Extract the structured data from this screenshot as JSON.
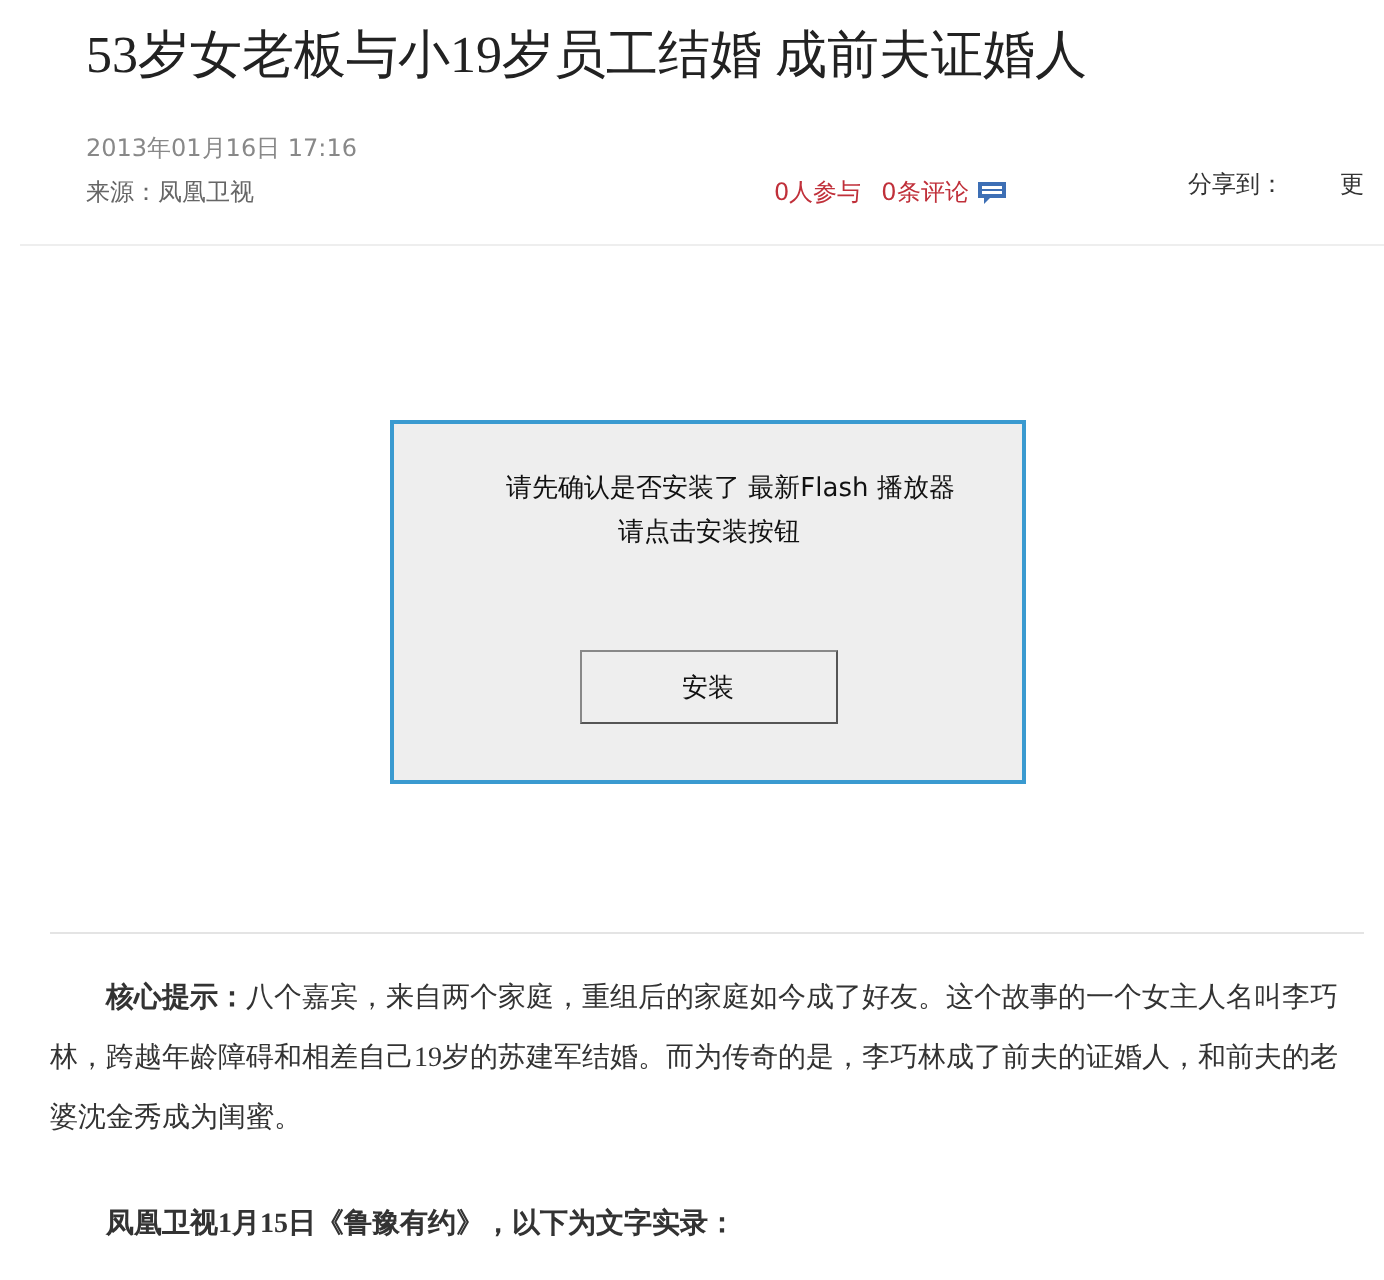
{
  "article": {
    "title": "53岁女老板与小19岁员工结婚 成前夫证婚人",
    "date": "2013年01月16日 17:16",
    "source": "来源：凤凰卫视",
    "participants": "0人参与",
    "comments": "0条评论",
    "share_label": "分享到：",
    "more": "更"
  },
  "flash_prompt": {
    "lines": [
      "请先确认是否安装了 最新Flash 播放器",
      "请点击安装按钮"
    ],
    "button": "安装"
  },
  "paragraphs": [
    {
      "kind": "summary",
      "text": "**核心提示：**八个嘉宾，来自两个家庭，重组后的家庭如今成了好友。这个故事的一个女主人名叫李巧林，跨越年龄障碍和相差自己19岁的苏建军结婚。而为传奇的是，李巧林成了前夫的证婚人，和前夫的老婆沈金秀成为闺蜜。"
    },
    {
      "kind": "heading",
      "text": "凤凰卫视1月15日《鲁豫有约》，以下为文字实录："
    }
  ]
}
